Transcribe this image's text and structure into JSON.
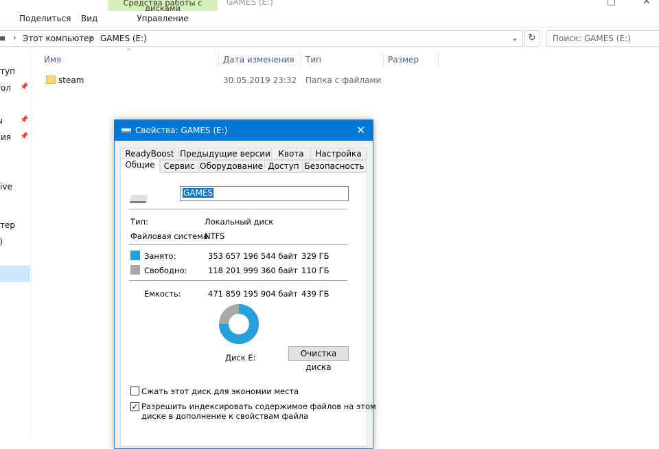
{
  "ribbon": {
    "tabs": [
      "Поделиться",
      "Вид"
    ],
    "context_group": "Средства работы с дисками",
    "context_tab": "Управление",
    "window_title": "GAMES (E:)"
  },
  "address": {
    "crumbs": [
      "Этот компьютер",
      "GAMES (E:)"
    ],
    "search_placeholder": "Поиск: GAMES (E:)"
  },
  "nav": {
    "items": [
      "ступ",
      "тол",
      "ы",
      "ния",
      "Live",
      "ютер",
      ")"
    ]
  },
  "columns": {
    "name": "Имя",
    "date": "Дата изменения",
    "type": "Тип",
    "size": "Размер"
  },
  "files": [
    {
      "name": "steam",
      "date": "30.05.2019 23:32",
      "type": "Папка с файлами"
    }
  ],
  "dialog": {
    "title": "Свойства: GAMES (E:)",
    "tabs_back": [
      "ReadyBoost",
      "Предыдущие версии",
      "Квота",
      "Настройка"
    ],
    "tabs_front": [
      "Общие",
      "Сервис",
      "Оборудование",
      "Доступ",
      "Безопасность"
    ],
    "volume_name": "GAMES",
    "type_label": "Тип:",
    "type_value": "Локальный диск",
    "fs_label": "Файловая система:",
    "fs_value": "NTFS",
    "used_label": "Занято:",
    "used_bytes": "353 657 196 544 байт",
    "used_gb": "329 ГБ",
    "free_label": "Свободно:",
    "free_bytes": "118 201 999 360 байт",
    "free_gb": "110 ГБ",
    "capacity_label": "Емкость:",
    "capacity_bytes": "471 859 195 904 байт",
    "capacity_gb": "439 ГБ",
    "disk_label": "Диск E:",
    "cleanup_button": "Очистка диска",
    "compress_label": "Сжать этот диск для экономии места",
    "compress_checked": false,
    "index_label_line1": "Разрешить индексировать содержимое файлов на этом",
    "index_label_line2": "диске в дополнение к свойствам файла",
    "index_checked": true,
    "used_fraction": 0.7495,
    "colors": {
      "used": "#26a0da",
      "free": "#a8a8a8",
      "accent": "#0078d7"
    }
  }
}
